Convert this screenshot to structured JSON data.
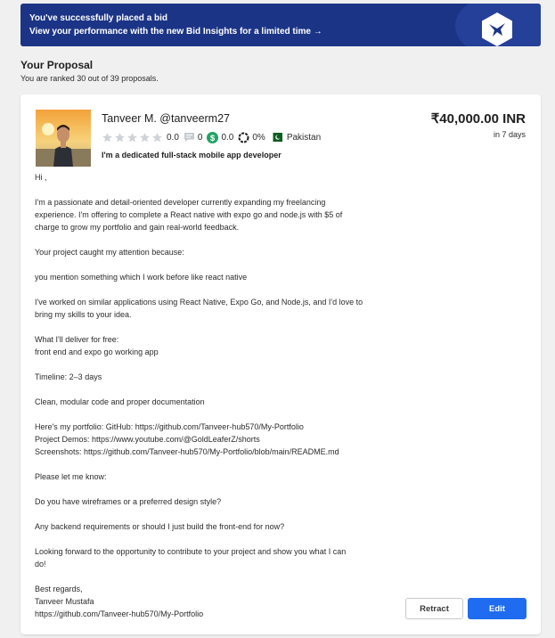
{
  "banner": {
    "title": "You've successfully placed a bid",
    "subtitle": "View your performance with the new Bid Insights for a limited time →",
    "logo_icon": "hummingbird-icon",
    "close_icon": "close-icon"
  },
  "proposal": {
    "section_title": "Your Proposal",
    "rank_text": "You are ranked 30 out of 39 proposals."
  },
  "bidder": {
    "name": "Tanveer M. @tanveerm27",
    "rating": "0.0",
    "reviews": "0",
    "earnings_score": "0.0",
    "completion": "0%",
    "country": "Pakistan",
    "tagline": "I'm a dedicated full-stack mobile app developer",
    "stars_filled": 0
  },
  "bid": {
    "amount": "₹40,000.00 INR",
    "duration": "in 7 days"
  },
  "message": [
    "Hi ,",
    "I'm a passionate and detail-oriented developer currently expanding my freelancing\nexperience. I'm offering to complete a React native with expo go and node.js with $5 of\ncharge to grow my portfolio and gain real-world feedback.",
    "Your project caught my attention because:",
    "you mention something which I work before like react native",
    "I've worked on similar applications using React Native, Expo Go, and Node.js, and I'd love to\nbring my skills to your idea.",
    "What I'll deliver for free:\nfront end and expo go working app",
    "Timeline: 2–3 days",
    "Clean, modular code and proper documentation",
    "Here's my portfolio: GitHub: https://github.com/Tanveer-hub570/My-Portfolio\nProject Demos: https://www.youtube.com/@GoldLeaferZ/shorts\nScreenshots: https://github.com/Tanveer-hub570/My-Portfolio/blob/main/README.md",
    "Please let me know:",
    "Do you have wireframes or a preferred design style?",
    "Any backend requirements or should I just build the front-end for now?",
    "Looking forward to the opportunity to contribute to your project and show you what I can\ndo!",
    "Best regards,\nTanveer Mustafa\nhttps://github.com/Tanveer-hub570/My-Portfolio"
  ],
  "actions": {
    "retract_label": "Retract",
    "edit_label": "Edit"
  },
  "colors": {
    "banner_bg": "#1b3486",
    "primary": "#1f6cf0",
    "earnings_badge": "#21a366"
  }
}
